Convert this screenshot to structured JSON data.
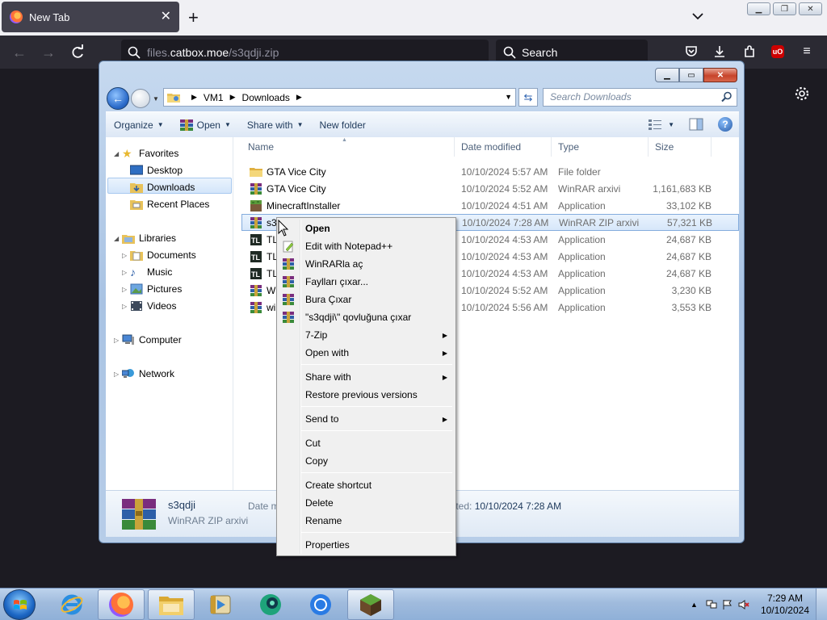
{
  "browser": {
    "tab_title": "New Tab",
    "url_prefix": "files.",
    "url_host": "catbox.moe",
    "url_path": "/s3qdji.zip",
    "search_placeholder": "Search"
  },
  "explorer": {
    "breadcrumb": [
      "VM1",
      "Downloads"
    ],
    "search_placeholder": "Search Downloads",
    "toolbar": {
      "organize": "Organize",
      "open": "Open",
      "share_with": "Share with",
      "new_folder": "New folder"
    },
    "nav": {
      "favorites": "Favorites",
      "desktop": "Desktop",
      "downloads": "Downloads",
      "recent_places": "Recent Places",
      "libraries": "Libraries",
      "documents": "Documents",
      "music": "Music",
      "pictures": "Pictures",
      "videos": "Videos",
      "computer": "Computer",
      "network": "Network"
    },
    "columns": {
      "name": "Name",
      "date_modified": "Date modified",
      "type": "Type",
      "size": "Size"
    },
    "files": [
      {
        "name": "GTA Vice City",
        "date": "10/10/2024 5:57 AM",
        "type": "File folder",
        "size": ""
      },
      {
        "name": "GTA Vice City",
        "date": "10/10/2024 5:52 AM",
        "type": "WinRAR arxivi",
        "size": "1,161,683 KB"
      },
      {
        "name": "MinecraftInstaller",
        "date": "10/10/2024 4:51 AM",
        "type": "Application",
        "size": "33,102 KB"
      },
      {
        "name": "s3c",
        "date": "10/10/2024 7:28 AM",
        "type": "WinRAR ZIP arxivi",
        "size": "57,321 KB"
      },
      {
        "name": "TL",
        "date": "10/10/2024 4:53 AM",
        "type": "Application",
        "size": "24,687 KB"
      },
      {
        "name": "TL",
        "date": "10/10/2024 4:53 AM",
        "type": "Application",
        "size": "24,687 KB"
      },
      {
        "name": "TL",
        "date": "10/10/2024 4:53 AM",
        "type": "Application",
        "size": "24,687 KB"
      },
      {
        "name": "Wi",
        "date": "10/10/2024 5:52 AM",
        "type": "Application",
        "size": "3,230 KB"
      },
      {
        "name": "wi",
        "date": "10/10/2024 5:56 AM",
        "type": "Application",
        "size": "3,553 KB"
      }
    ],
    "details": {
      "name": "s3qdji",
      "type": "WinRAR ZIP arxivi",
      "date_label": "Date m",
      "created_label": "eated:",
      "created_value": "10/10/2024 7:28 AM"
    }
  },
  "context_menu": {
    "open": "Open",
    "edit_notepad": "Edit with Notepad++",
    "winrar_open": "WinRARla aç",
    "extract_files": "Faylları çıxar...",
    "extract_here": "Bura Çıxar",
    "extract_to": "\"s3qdji\\\" qovluğuna çıxar",
    "seven_zip": "7-Zip",
    "open_with": "Open with",
    "share_with": "Share with",
    "restore_versions": "Restore previous versions",
    "send_to": "Send to",
    "cut": "Cut",
    "copy": "Copy",
    "create_shortcut": "Create shortcut",
    "delete": "Delete",
    "rename": "Rename",
    "properties": "Properties"
  },
  "taskbar": {
    "time": "7:29 AM",
    "date": "10/10/2024"
  },
  "colors": {
    "selection": "#d7e7fa",
    "ff_dark": "#2b2a33",
    "taskbar": "#a0bbdd"
  }
}
